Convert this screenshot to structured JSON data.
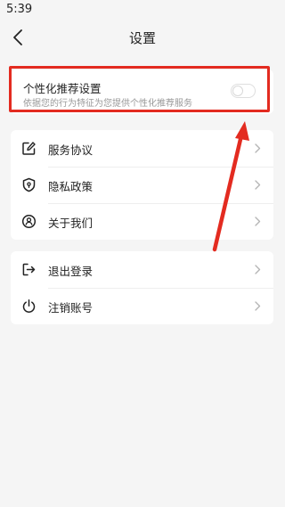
{
  "status_bar": {
    "time": "5:39"
  },
  "nav": {
    "title": "设置",
    "back_icon": "chevron-left-icon"
  },
  "personalized": {
    "title": "个性化推荐设置",
    "description": "依据您的行为特征为您提供个性化推荐服务",
    "enabled": false
  },
  "menu_group_1": [
    {
      "label": "服务协议",
      "icon": "edit-icon"
    },
    {
      "label": "隐私政策",
      "icon": "shield-icon"
    },
    {
      "label": "关于我们",
      "icon": "user-circle-icon"
    }
  ],
  "menu_group_2": [
    {
      "label": "退出登录",
      "icon": "logout-icon"
    },
    {
      "label": "注销账号",
      "icon": "power-icon"
    }
  ],
  "colors": {
    "annotation": "#e32b20",
    "background": "#f5f5f5",
    "card": "#ffffff"
  }
}
